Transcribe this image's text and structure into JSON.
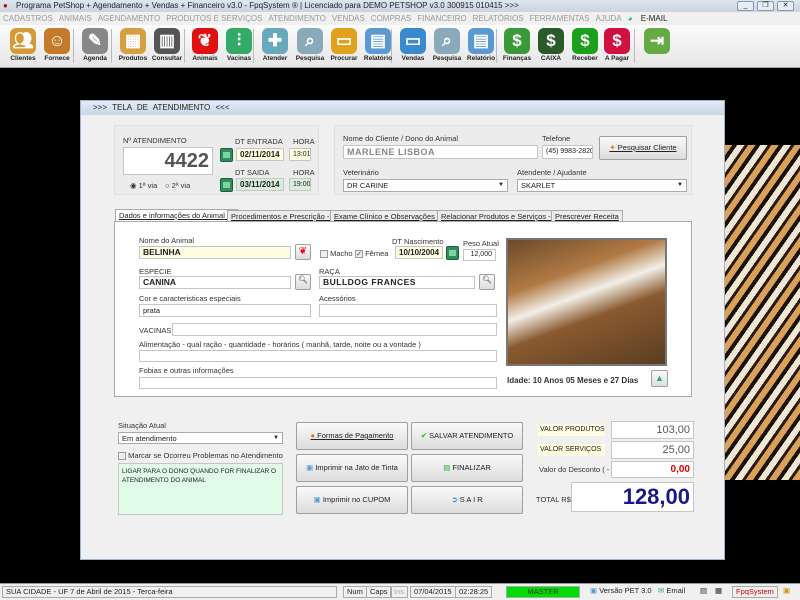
{
  "window": {
    "title": "Programa PetShop + Agendamento + Vendas + Financeiro v3.0 - FpqSystem ® | Licenciado para  DEMO PETSHOP v3.0 300915 010415 >>>"
  },
  "menu": [
    "CADASTROS",
    "ANIMAIS",
    "AGENDAMENTO",
    "PRODUTOS E SERVIÇOS",
    "ATENDIMENTO",
    "VENDAS",
    "COMPRAS",
    "FINANCEIRO",
    "RELATÓRIOS",
    "FERRAMENTAS",
    "AJUDA"
  ],
  "menu_email": "E-MAIL",
  "toolbar": [
    {
      "label": "Clientes",
      "icon": "users-icon",
      "color": "#d49a3a"
    },
    {
      "label": "Fornece",
      "icon": "supplier-icon",
      "color": "#c47a2a"
    },
    {
      "label": "Agenda",
      "icon": "agenda-icon",
      "color": "#888"
    },
    {
      "label": "Produtos",
      "icon": "boxes-icon",
      "color": "#d4a040"
    },
    {
      "label": "Consultar",
      "icon": "barcode-icon",
      "color": "#555"
    },
    {
      "label": "Animais",
      "icon": "paw-icon",
      "color": "#e01010"
    },
    {
      "label": "Vacinas",
      "icon": "syringe-icon",
      "color": "#3a6"
    },
    {
      "label": "Atender",
      "icon": "vet-paw-icon",
      "color": "#6ab"
    },
    {
      "label": "Pesquisa",
      "icon": "search-doc-icon",
      "color": "#8ab"
    },
    {
      "label": "Procurar",
      "icon": "folder-icon",
      "color": "#e0a020"
    },
    {
      "label": "Relatório",
      "icon": "printer-icon",
      "color": "#5a9ad0"
    },
    {
      "label": "Vendas",
      "icon": "monitor-icon",
      "color": "#3a8ad0"
    },
    {
      "label": "Pesquisa",
      "icon": "search-doc-icon",
      "color": "#8ab"
    },
    {
      "label": "Relatório",
      "icon": "printer-icon",
      "color": "#5a9ad0"
    },
    {
      "label": "Finanças",
      "icon": "finance-icon",
      "color": "#3a9a3a"
    },
    {
      "label": "CAIXA",
      "icon": "cashbook-icon",
      "color": "#2a5a2a"
    },
    {
      "label": "Receber",
      "icon": "dollar-green-icon",
      "color": "#1aa01a"
    },
    {
      "label": "A Pagar",
      "icon": "dollar-red-icon",
      "color": "#d01040"
    },
    {
      "label": "",
      "icon": "exit-door-icon",
      "color": "#6a4"
    }
  ],
  "dialog": {
    "title": ">>>  TELA DE ATENDIMENTO  <<<",
    "num_label": "Nº ATENDIMENTO",
    "num": "4422",
    "via1": "1ª via",
    "via2": "2ª via",
    "dt_entrada_label": "DT ENTRADA",
    "dt_entrada": "02/11/2014",
    "hora_label": "HORA",
    "hora_entrada": "13:01",
    "dt_saida_label": "DT SAIDA",
    "dt_saida": "03/11/2014",
    "hora_saida": "19:00",
    "cliente_label": "Nome do Cliente / Dono do Animal",
    "cliente": "MARLENE LISBOA",
    "telefone_label": "Telefone",
    "telefone": "(45) 9983-2820",
    "pesquisar_cliente": "Pesquisar Cliente",
    "vet_label": "Veterinário",
    "vet": "DR CARINE",
    "atendente_label": "Atendente / Ajudante",
    "atendente": "SKARLET",
    "tabs": [
      "Dados e informações do Animal ->",
      "Procedimentos e Prescrição ->",
      "Exame Clínico e Observações ->",
      "Relacionar Produtos e Serviços ->",
      "Prescrever Receita"
    ],
    "animal": {
      "nome_label": "Nome do Animal",
      "nome": "BELINHA",
      "macho": "Macho",
      "femea": "Fêmea",
      "femea_checked": true,
      "nasc_label": "DT Nascimento",
      "nasc": "10/10/2004",
      "peso_label": "Peso Atual",
      "peso": "12,000",
      "especie_label": "ESPECIE",
      "especie": "CANINA",
      "raca_label": "RAÇA",
      "raca": "BULLDOG FRANCES",
      "cor_label": "Cor e caracteristicas especiais",
      "cor": "prata",
      "acess_label": "Acessórios",
      "acess": "",
      "vacinas_label": "VACINAS",
      "vacinas": "",
      "alim_label": "Alimentação - qual ração - quantidade - horários ( manhã, tarde, noite ou a vontade )",
      "alim": "",
      "fobias_label": "Fobias e outras informações",
      "fobias": "",
      "idade": "Idade: 10 Anos 05 Meses e 27 Dias"
    },
    "situacao_label": "Situação Atual",
    "situacao": "Em atendimento",
    "problemas_label": "Marcar se Ocorreu Problemas no Atendimento",
    "obs": "LIGAR PARA O DONO QUANDO FOR FINALIZAR O ATENDIMENTO DO ANIMAL",
    "buttons": {
      "formas": "Formas de Pagamento",
      "salvar": "SALVAR ATENDIMENTO",
      "jato": "Imprimir na Jato de Tinta",
      "finalizar": "FINALIZAR",
      "cupom": "Imprimir no CUPOM",
      "sair": "S A I R"
    },
    "valor_produtos_label": "VALOR PRODUTOS",
    "valor_produtos": "103,00",
    "valor_servicos_label": "VALOR SERVIÇOS",
    "valor_servicos": "25,00",
    "desconto_label": "Valor do Desconto ( - )",
    "desconto": "0,00",
    "total_label": "TOTAL R$",
    "total": "128,00"
  },
  "status": {
    "cidade": "SUA CIDADE - UF  7 de Abril de 2015 - Terca-feira",
    "num": "Num",
    "caps": "Caps",
    "ins": "Ins",
    "data": "07/04/2015",
    "hora": "02:28:25",
    "user": "MASTER",
    "versao": "Versão PET 3.0",
    "email": "Email",
    "brand": "FpqSystem"
  }
}
